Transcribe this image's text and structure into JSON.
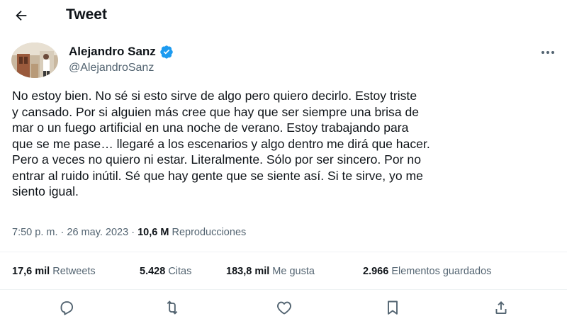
{
  "header": {
    "title": "Tweet",
    "back_icon": "arrow-left-icon"
  },
  "author": {
    "name": "Alejandro Sanz",
    "handle": "@AlejandroSanz",
    "verified": true,
    "verified_color": "#1d9bf0"
  },
  "tweet": {
    "text": "No estoy bien. No sé si esto sirve de algo pero quiero decirlo. Estoy triste\ny cansado. Por si alguien más cree que hay que ser siempre una brisa de\nmar o un fuego artificial en una noche de verano. Estoy trabajando para\nque se me pase… llegaré a los escenarios y algo dentro me dirá que hacer.\nPero a veces no quiero ni estar. Literalmente. Sólo por ser sincero. Por no\nentrar al ruido inútil. Sé que hay gente que se siente así. Si te sirve, yo me\nsiento igual.",
    "time": "7:50 p. m.",
    "separator": "·",
    "date": "26 may. 2023",
    "views_count": "10,6 M",
    "views_label": "Reproducciones"
  },
  "stats": {
    "retweets_count": "17,6 mil",
    "retweets_label": "Retweets",
    "quotes_count": "5.428",
    "quotes_label": "Citas",
    "likes_count": "183,8 mil",
    "likes_label": "Me gusta",
    "bookmarks_count": "2.966",
    "bookmarks_label": "Elementos guardados"
  },
  "actions": [
    {
      "icon": "reply-icon"
    },
    {
      "icon": "retweet-icon"
    },
    {
      "icon": "like-icon"
    },
    {
      "icon": "bookmark-icon"
    },
    {
      "icon": "share-icon"
    }
  ],
  "colors": {
    "text": "#0f1419",
    "secondary": "#536471",
    "divider": "#eff3f4",
    "accent": "#1d9bf0"
  }
}
